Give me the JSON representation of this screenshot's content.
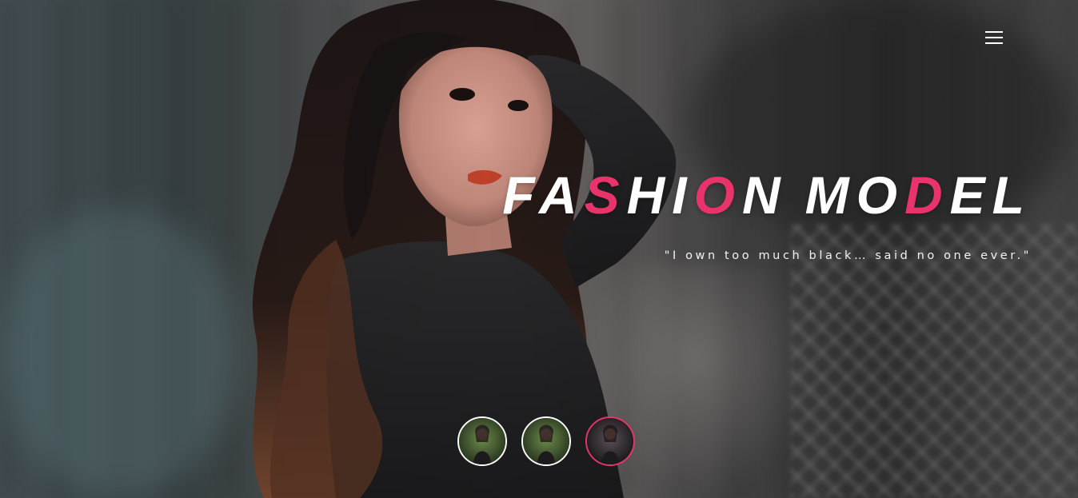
{
  "nav": {
    "menu_icon": "hamburger-menu-icon"
  },
  "hero": {
    "headline_parts": [
      {
        "text": "FA",
        "accent": false
      },
      {
        "text": "S",
        "accent": true
      },
      {
        "text": "HI",
        "accent": false
      },
      {
        "text": "O",
        "accent": true
      },
      {
        "text": "N",
        "accent": false
      },
      {
        "text": " ",
        "accent": false
      },
      {
        "text": "MO",
        "accent": false
      },
      {
        "text": "D",
        "accent": true
      },
      {
        "text": "EL",
        "accent": false
      }
    ],
    "tagline": "\"I own too much black… said no one ever.\""
  },
  "thumbnails": [
    {
      "label": "slide-1",
      "active": false,
      "tone": "green"
    },
    {
      "label": "slide-2",
      "active": false,
      "tone": "green"
    },
    {
      "label": "slide-3",
      "active": true,
      "tone": "dark"
    }
  ],
  "colors": {
    "accent": "#e8336b",
    "text": "#ffffff"
  }
}
